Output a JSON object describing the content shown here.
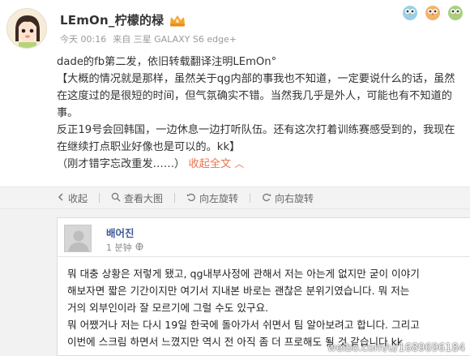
{
  "header": {
    "author_name": "LEmOn_柠檬的椂",
    "timestamp": "今天 00:16",
    "source": "来自 三星 GALAXY S6 edge+"
  },
  "post": {
    "line_intro": "dade的fb第二发，依旧转载翻译注明LEmOn°",
    "para1": "【大概的情况就是那样，虽然关于qg内部的事我也不知道，一定要说什么的话，虽然在这度过的是很短的时间，但气氛确实不错。当然我几乎是外人，可能也有不知道的事。",
    "para2": "反正19号会回韩国，一边休息一边打听队伍。还有这次打着训练赛感受到的，我现在在继续打点职业好像也是可以的。kk】",
    "note": "（刚才错字忘改重发……）",
    "collapse_label": "收起全文"
  },
  "toolbar": {
    "items": [
      {
        "label": "收起",
        "icon": "collapse-arrow-icon"
      },
      {
        "label": "查看大图",
        "icon": "magnifier-icon"
      },
      {
        "label": "向左旋转",
        "icon": "rotate-left-icon"
      },
      {
        "label": "向右旋转",
        "icon": "rotate-right-icon"
      }
    ]
  },
  "embed": {
    "name": "배어진",
    "time": "1 분钟",
    "text_line1": "뭐 대충 상황은 저렇게 됐고, qg내부사정에 관해서 저는 아는게 없지만 굳이 이야기",
    "text_line2": "해보자면 짧은 기간이지만 여기서 지내본 바로는 괜찮은 분위기였습니다. 뭐 저는",
    "text_line3": "거의 외부인이라 잘 모르기에 그럴 수도 있구요.",
    "text_line4": "뭐 어쨌거나 저는 다시 19일 한국에 돌아가서 쉬면서 팀 알아보려고 합니다. 그리고",
    "text_line5": "이번에 스크림 하면서 느꼈지만 역시 전 아직 좀 더 프로해도 될 것 같습니다 kk"
  },
  "watermark": "weibo.com/u/1689696184",
  "colors": {
    "accent": "#eb7350",
    "link_blue": "#3b5998",
    "toolbar_bg": "#f3f3f3"
  }
}
